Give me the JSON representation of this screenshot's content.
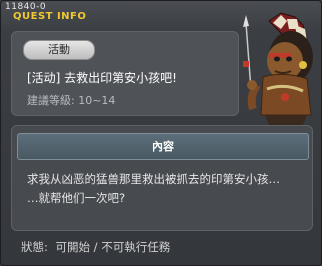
{
  "window": {
    "id_label": "11840-0",
    "title": "QUEST INFO"
  },
  "quest": {
    "category_tag": "活動",
    "name": "[活动] 去救出印第安小孩吧!",
    "level_label": "建議等級: 10~14",
    "portrait_icon": "native-chief-portrait"
  },
  "content": {
    "header": "內容",
    "lines": [
      "求我从凶恶的猛兽那里救出被抓去的印第安小孩…",
      "…就帮他们一次吧?"
    ]
  },
  "status": {
    "label": "狀態:",
    "value": "可開始 / 不可執行任務"
  },
  "colors": {
    "title_accent": "#f0c830",
    "content_header_bg": "#55666f"
  }
}
